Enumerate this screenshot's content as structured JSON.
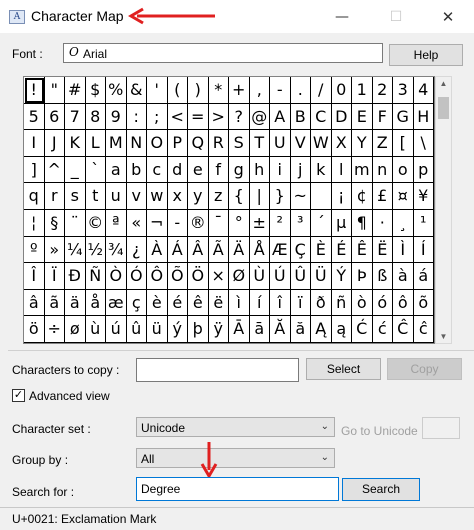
{
  "window": {
    "title": "Character Map",
    "minimize_glyph": "—",
    "maximize_glyph": "☐",
    "close_glyph": "✕",
    "app_icon_glyph": "A"
  },
  "font": {
    "label": "Font :",
    "value": "Arial",
    "icon_glyph": "O",
    "help_label": "Help"
  },
  "grid": {
    "rows": [
      [
        "!",
        "\"",
        "#",
        "$",
        "%",
        "&",
        "'",
        "(",
        ")",
        "*",
        "+",
        ",",
        "-",
        ".",
        "/",
        "0",
        "1",
        "2",
        "3",
        "4"
      ],
      [
        "5",
        "6",
        "7",
        "8",
        "9",
        ":",
        ";",
        "<",
        "=",
        ">",
        "?",
        "@",
        "A",
        "B",
        "C",
        "D",
        "E",
        "F",
        "G",
        "H"
      ],
      [
        "I",
        "J",
        "K",
        "L",
        "M",
        "N",
        "O",
        "P",
        "Q",
        "R",
        "S",
        "T",
        "U",
        "V",
        "W",
        "X",
        "Y",
        "Z",
        "[",
        "\\"
      ],
      [
        "]",
        "^",
        "_",
        "`",
        "a",
        "b",
        "c",
        "d",
        "e",
        "f",
        "g",
        "h",
        "i",
        "j",
        "k",
        "l",
        "m",
        "n",
        "o",
        "p"
      ],
      [
        "q",
        "r",
        "s",
        "t",
        "u",
        "v",
        "w",
        "x",
        "y",
        "z",
        "{",
        "|",
        "}",
        "~",
        "",
        "¡",
        "¢",
        "£",
        "¤",
        "¥"
      ],
      [
        "¦",
        "§",
        "¨",
        "©",
        "ª",
        "«",
        "¬",
        "-",
        "®",
        "¯",
        "°",
        "±",
        "²",
        "³",
        "´",
        "µ",
        "¶",
        "·",
        "¸",
        "¹"
      ],
      [
        "º",
        "»",
        "¼",
        "½",
        "¾",
        "¿",
        "À",
        "Á",
        "Â",
        "Ã",
        "Ä",
        "Å",
        "Æ",
        "Ç",
        "È",
        "É",
        "Ê",
        "Ë",
        "Ì",
        "Í"
      ],
      [
        "Î",
        "Ï",
        "Ð",
        "Ñ",
        "Ò",
        "Ó",
        "Ô",
        "Õ",
        "Ö",
        "×",
        "Ø",
        "Ù",
        "Ú",
        "Û",
        "Ü",
        "Ý",
        "Þ",
        "ß",
        "à",
        "á"
      ],
      [
        "â",
        "ã",
        "ä",
        "å",
        "æ",
        "ç",
        "è",
        "é",
        "ê",
        "ë",
        "ì",
        "í",
        "î",
        "ï",
        "ð",
        "ñ",
        "ò",
        "ó",
        "ô",
        "õ"
      ],
      [
        "ö",
        "÷",
        "ø",
        "ù",
        "ú",
        "û",
        "ü",
        "ý",
        "þ",
        "ÿ",
        "Ā",
        "ā",
        "Ă",
        "ă",
        "Ą",
        "ą",
        "Ć",
        "ć",
        "Ĉ",
        "ĉ"
      ]
    ]
  },
  "scrollbar": {
    "up_glyph": "▲",
    "down_glyph": "▼"
  },
  "copy": {
    "label": "Characters to copy :",
    "value": "",
    "select_label": "Select",
    "copy_label": "Copy"
  },
  "advanced": {
    "label": "Advanced view",
    "checked_glyph": "✓"
  },
  "charset": {
    "label": "Character set :",
    "value": "Unicode",
    "goto_label": "Go to Unicode :",
    "dropdown_glyph": "⌄"
  },
  "group": {
    "label": "Group by :",
    "value": "All",
    "dropdown_glyph": "⌄"
  },
  "search": {
    "label": "Search for :",
    "value": "Degree",
    "button_label": "Search"
  },
  "status": {
    "text": "U+0021: Exclamation Mark"
  },
  "colors": {
    "annotation_red": "#e02020",
    "focus_blue": "#0078d7"
  }
}
